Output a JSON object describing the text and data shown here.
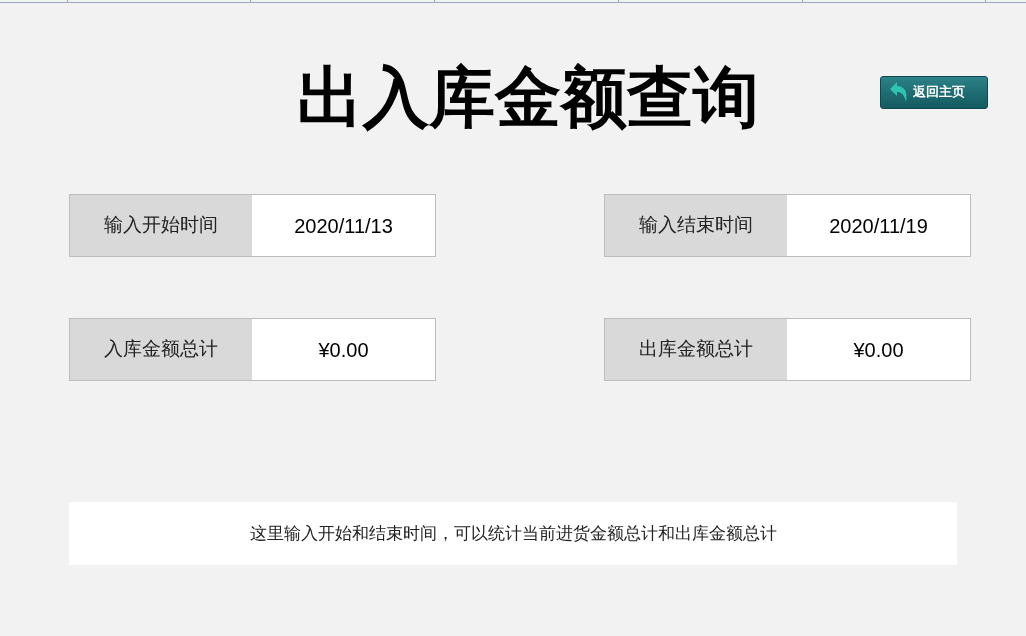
{
  "title": "出入库金额查询",
  "home_button": {
    "label": "返回主页"
  },
  "fields": [
    {
      "label": "输入开始时间",
      "value": "2020/11/13"
    },
    {
      "label": "输入结束时间",
      "value": "2020/11/19"
    },
    {
      "label": "入库金额总计",
      "value": "¥0.00"
    },
    {
      "label": "出库金额总计",
      "value": "¥0.00"
    }
  ],
  "note": "这里输入开始和结束时间，可以统计当前进货金额总计和出库金额总计"
}
